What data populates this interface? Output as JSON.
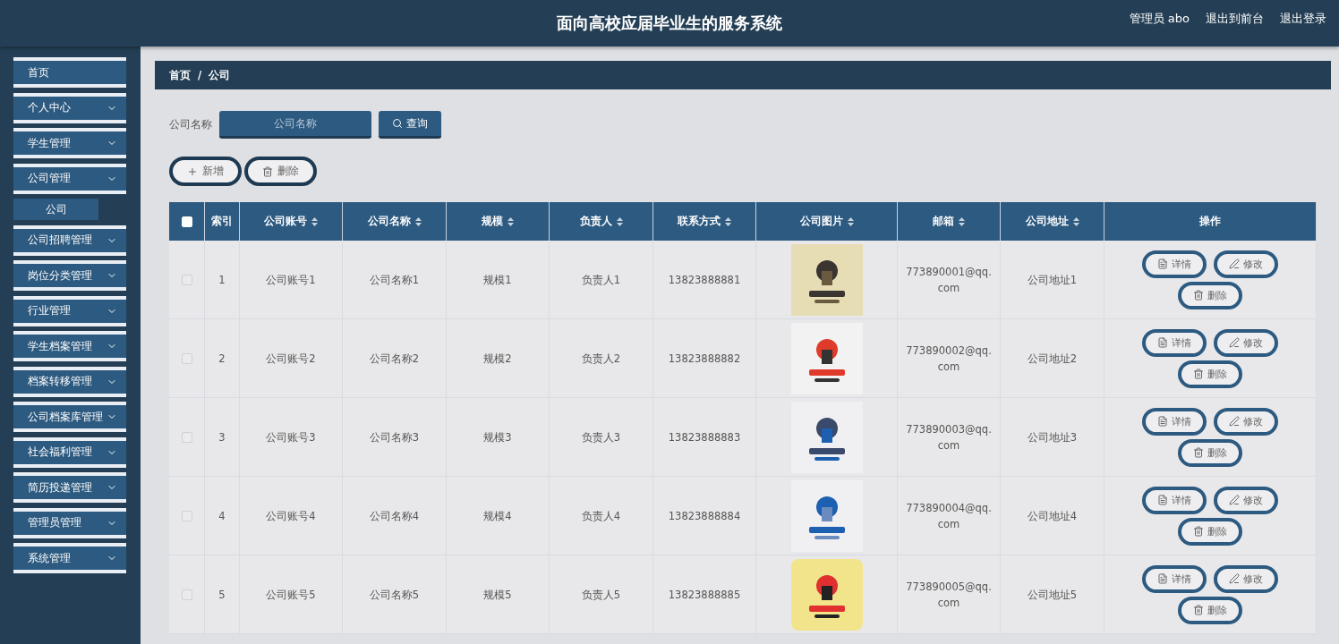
{
  "header": {
    "title": "面向高校应届毕业生的服务系统",
    "links": [
      {
        "label": "管理员 abo"
      },
      {
        "label": "退出到前台"
      },
      {
        "label": "退出登录"
      }
    ]
  },
  "sidebar": {
    "items": [
      {
        "label": "首页",
        "kind": "link"
      },
      {
        "label": "个人中心",
        "kind": "menu"
      },
      {
        "label": "学生管理",
        "kind": "menu"
      },
      {
        "label": "公司管理",
        "kind": "menu",
        "children": [
          {
            "label": "公司",
            "selected": true
          }
        ]
      },
      {
        "label": "公司招聘管理",
        "kind": "menu"
      },
      {
        "label": "岗位分类管理",
        "kind": "menu"
      },
      {
        "label": "行业管理",
        "kind": "menu"
      },
      {
        "label": "学生档案管理",
        "kind": "menu"
      },
      {
        "label": "档案转移管理",
        "kind": "menu"
      },
      {
        "label": "公司档案库管理",
        "kind": "menu"
      },
      {
        "label": "社会福利管理",
        "kind": "menu"
      },
      {
        "label": "简历投递管理",
        "kind": "menu"
      },
      {
        "label": "管理员管理",
        "kind": "menu"
      },
      {
        "label": "系统管理",
        "kind": "menu"
      }
    ]
  },
  "breadcrumb": {
    "items": [
      "首页",
      "公司"
    ],
    "separator": "/"
  },
  "search": {
    "label": "公司名称",
    "placeholder": "公司名称",
    "button": "查询"
  },
  "toolbar": [
    {
      "kind": "add",
      "label": "新增"
    },
    {
      "kind": "delete",
      "label": "删除"
    }
  ],
  "table": {
    "select_all": {
      "checked": false
    },
    "columns": [
      {
        "label": "索引",
        "sortable": false
      },
      {
        "label": "公司账号",
        "sortable": true
      },
      {
        "label": "公司名称",
        "sortable": true
      },
      {
        "label": "规模",
        "sortable": true
      },
      {
        "label": "负责人",
        "sortable": true
      },
      {
        "label": "联系方式",
        "sortable": true
      },
      {
        "label": "公司图片",
        "sortable": true
      },
      {
        "label": "邮箱",
        "sortable": true
      },
      {
        "label": "公司地址",
        "sortable": true
      },
      {
        "label": "操作",
        "sortable": false
      }
    ],
    "rows": [
      {
        "checked": false,
        "cells": [
          "1",
          "公司账号1",
          "公司名称1",
          "规模1",
          "负责人1",
          "13823888881",
          {
            "kind": "picture"
          },
          "773890001@qq.com",
          "公司地址1"
        ],
        "actions": [
          {
            "kind": "detail",
            "label": "详情"
          },
          {
            "kind": "edit",
            "label": "修改"
          },
          {
            "kind": "delete",
            "label": "删除"
          }
        ]
      },
      {
        "checked": false,
        "cells": [
          "2",
          "公司账号2",
          "公司名称2",
          "规模2",
          "负责人2",
          "13823888882",
          {
            "kind": "picture"
          },
          "773890002@qq.com",
          "公司地址2"
        ],
        "actions": [
          {
            "kind": "detail",
            "label": "详情"
          },
          {
            "kind": "edit",
            "label": "修改"
          },
          {
            "kind": "delete",
            "label": "删除"
          }
        ]
      },
      {
        "checked": false,
        "cells": [
          "3",
          "公司账号3",
          "公司名称3",
          "规模3",
          "负责人3",
          "13823888883",
          {
            "kind": "picture"
          },
          "773890003@qq.com",
          "公司地址3"
        ],
        "actions": [
          {
            "kind": "detail",
            "label": "详情"
          },
          {
            "kind": "edit",
            "label": "修改"
          },
          {
            "kind": "delete",
            "label": "删除"
          }
        ]
      },
      {
        "checked": false,
        "cells": [
          "4",
          "公司账号4",
          "公司名称4",
          "规模4",
          "负责人4",
          "13823888884",
          {
            "kind": "picture"
          },
          "773890004@qq.com",
          "公司地址4"
        ],
        "actions": [
          {
            "kind": "detail",
            "label": "详情"
          },
          {
            "kind": "edit",
            "label": "修改"
          },
          {
            "kind": "delete",
            "label": "删除"
          }
        ]
      },
      {
        "checked": false,
        "cells": [
          "5",
          "公司账号5",
          "公司名称5",
          "规模5",
          "负责人5",
          "13823888885",
          {
            "kind": "picture"
          },
          "773890005@qq.com",
          "公司地址5"
        ],
        "actions": [
          {
            "kind": "detail",
            "label": "详情"
          },
          {
            "kind": "edit",
            "label": "修改"
          },
          {
            "kind": "delete",
            "label": "删除"
          }
        ]
      }
    ]
  }
}
